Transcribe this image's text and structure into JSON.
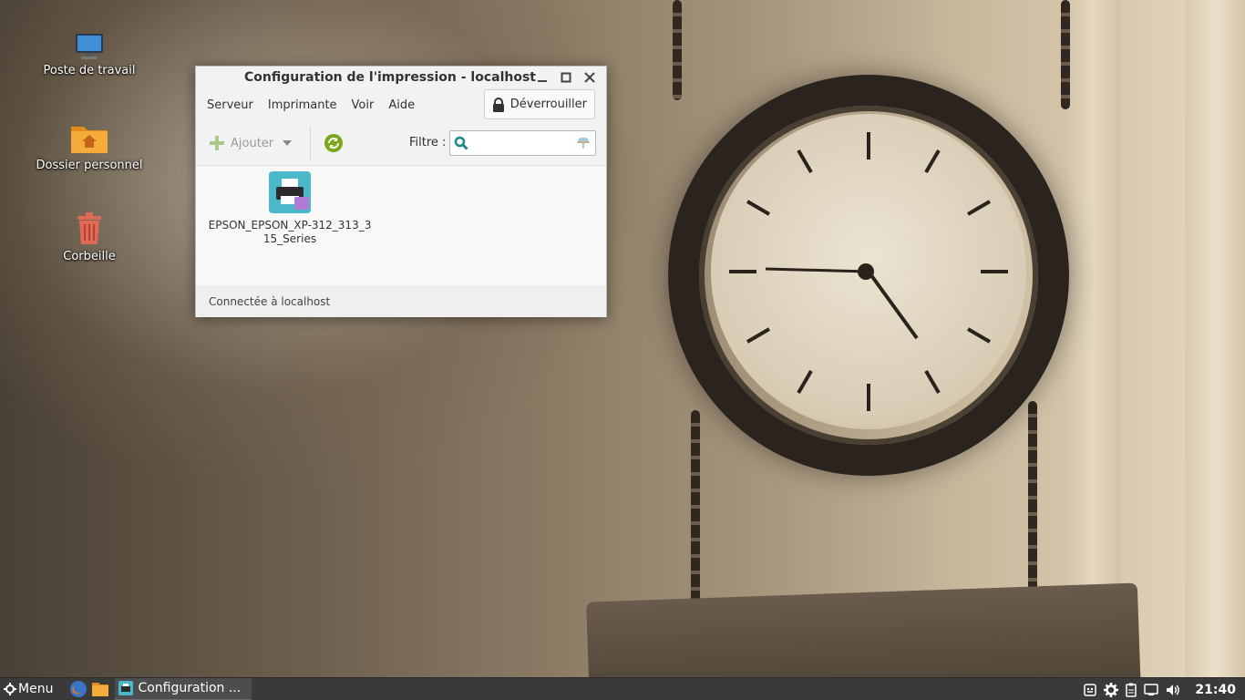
{
  "desktop": {
    "icons": [
      {
        "label": "Poste de travail"
      },
      {
        "label": "Dossier personnel"
      },
      {
        "label": "Corbeille"
      }
    ]
  },
  "window": {
    "title": "Configuration de l'impression - localhost",
    "menu": [
      "Serveur",
      "Imprimante",
      "Voir",
      "Aide"
    ],
    "unlock_label": "Déverrouiller",
    "toolbar": {
      "add_label": "Ajouter",
      "filter_label": "Filtre :",
      "filter_value": ""
    },
    "printers": [
      {
        "name": "EPSON_EPSON_XP-312_313_315_Series"
      }
    ],
    "status": "Connectée à localhost"
  },
  "taskbar": {
    "menu_label": "Menu",
    "task_label": "Configuration ...",
    "clock": "21:40"
  },
  "colors": {
    "taskbar_bg": "#3a3a3a",
    "refresh_green": "#7aa61a",
    "add_green": "#8cbf3f",
    "folder_orange": "#f0a030",
    "trash_red": "#e06a55",
    "printer_tile": "#4ab8c8"
  }
}
